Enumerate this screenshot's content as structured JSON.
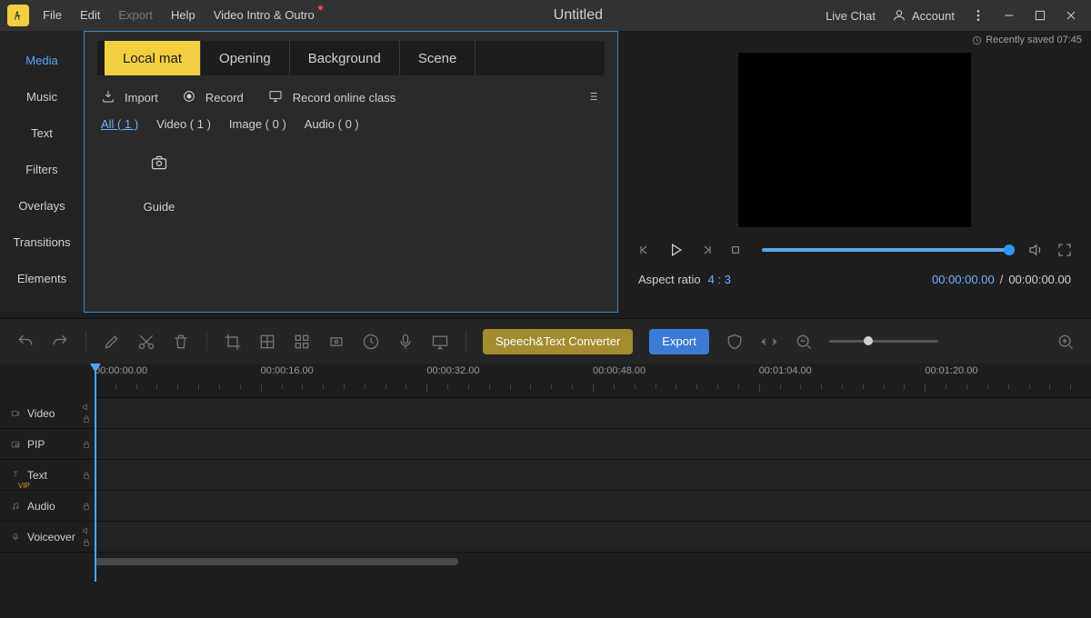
{
  "titlebar": {
    "menus": {
      "file": "File",
      "edit": "Edit",
      "export": "Export",
      "help": "Help",
      "intro": "Video Intro & Outro"
    },
    "doc_title": "Untitled",
    "live_chat": "Live Chat",
    "account": "Account"
  },
  "saved": {
    "label": "Recently saved 07:45"
  },
  "sidebar": {
    "items": [
      "Media",
      "Music",
      "Text",
      "Filters",
      "Overlays",
      "Transitions",
      "Elements"
    ]
  },
  "source_tabs": {
    "local": "Local mat",
    "opening": "Opening",
    "background": "Background",
    "scene": "Scene"
  },
  "actions": {
    "import": "Import",
    "record": "Record",
    "record_online": "Record online class"
  },
  "filters": {
    "all": "All ( 1 )",
    "video": "Video ( 1 )",
    "image": "Image ( 0 )",
    "audio": "Audio ( 0 )"
  },
  "thumb": {
    "label": "Guide"
  },
  "preview": {
    "aspect_label": "Aspect ratio",
    "aspect_value": "4 : 3",
    "time_cur": "00:00:00.00",
    "time_total": "00:00:00.00"
  },
  "toolbar": {
    "speech": "Speech&Text Converter",
    "export": "Export"
  },
  "ruler": [
    "00:00:00.00",
    "00:00:16.00",
    "00:00:32.00",
    "00:00:48.00",
    "00:01:04.00",
    "00:01:20.00"
  ],
  "tracks": {
    "video": "Video",
    "pip": "PIP",
    "text": "Text",
    "audio": "Audio",
    "voice": "Voiceover"
  }
}
